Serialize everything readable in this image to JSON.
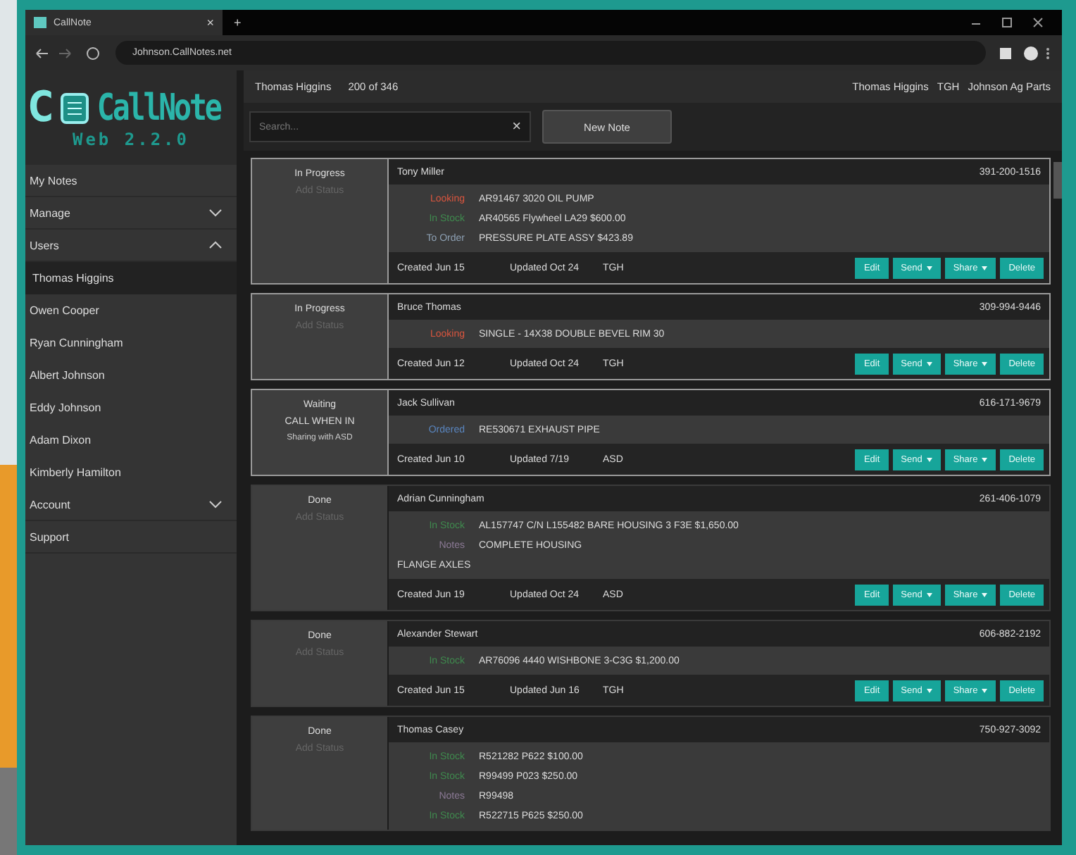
{
  "browser": {
    "tab_title": "CallNote",
    "tab_close": "×",
    "new_tab": "+",
    "url": "Johnson.CallNotes.net"
  },
  "logo": {
    "letter": "C",
    "name": "CallNote",
    "version": "Web 2.2.0"
  },
  "sidebar": {
    "items": [
      {
        "label": "My Notes",
        "kind": "link",
        "selected": false
      },
      {
        "label": "Manage",
        "kind": "group",
        "expanded": false
      },
      {
        "label": "Users",
        "kind": "group",
        "expanded": true
      },
      {
        "label": "Thomas Higgins",
        "kind": "user",
        "selected": true
      },
      {
        "label": "Owen Cooper",
        "kind": "user",
        "selected": false
      },
      {
        "label": "Ryan Cunningham",
        "kind": "user",
        "selected": false
      },
      {
        "label": "Albert Johnson",
        "kind": "user",
        "selected": false
      },
      {
        "label": "Eddy Johnson",
        "kind": "user",
        "selected": false
      },
      {
        "label": "Adam Dixon",
        "kind": "user",
        "selected": false
      },
      {
        "label": "Kimberly Hamilton",
        "kind": "user",
        "selected": false
      },
      {
        "label": "Account",
        "kind": "group",
        "expanded": false
      },
      {
        "label": "Support",
        "kind": "link",
        "selected": false
      }
    ]
  },
  "header": {
    "user": "Thomas Higgins",
    "count": "200 of 346",
    "account_user": "Thomas Higgins",
    "initials": "TGH",
    "company": "Johnson Ag Parts"
  },
  "search": {
    "placeholder": "Search...",
    "clear": "×"
  },
  "new_note": "New Note",
  "notes": [
    {
      "outlined": true,
      "status": "In Progress",
      "add_status": "Add Status",
      "name": "Tony Miller",
      "phone": "391-200-1516",
      "items": [
        {
          "tag": "Looking",
          "color": "#d9553e",
          "text": "AR91467 3020 OIL PUMP"
        },
        {
          "tag": "In Stock",
          "color": "#3f8a4e",
          "text": "AR40565 Flywheel LA29 $600.00"
        },
        {
          "tag": "To Order",
          "color": "#8da0b3",
          "text": "PRESSURE PLATE ASSY $423.89"
        }
      ],
      "created": "Created Jun 15",
      "updated": "Updated Oct 24",
      "by": "TGH",
      "buttons": [
        {
          "label": "Edit",
          "menu": false
        },
        {
          "label": "Send",
          "menu": true
        },
        {
          "label": "Share",
          "menu": true
        },
        {
          "label": "Delete",
          "menu": false
        }
      ]
    },
    {
      "outlined": true,
      "status": "In Progress",
      "add_status": "Add Status",
      "name": "Bruce Thomas",
      "phone": "309-994-9446",
      "items": [
        {
          "tag": "Looking",
          "color": "#d9553e",
          "text": "SINGLE - 14X38 DOUBLE BEVEL RIM 30"
        }
      ],
      "created": "Created Jun 12",
      "updated": "Updated Oct 24",
      "by": "TGH",
      "buttons": [
        {
          "label": "Edit",
          "menu": false
        },
        {
          "label": "Send",
          "menu": true
        },
        {
          "label": "Share",
          "menu": true
        },
        {
          "label": "Delete",
          "menu": false
        }
      ]
    },
    {
      "outlined": true,
      "status": "Waiting",
      "status_notes": [
        "CALL WHEN IN",
        "Sharing with ASD"
      ],
      "name": "Jack Sullivan",
      "phone": "616-171-9679",
      "items": [
        {
          "tag": "Ordered",
          "color": "#5a86c0",
          "text": "RE530671 EXHAUST PIPE"
        }
      ],
      "created": "Created Jun 10",
      "updated": "Updated 7/19",
      "by": "ASD",
      "buttons": [
        {
          "label": "Edit",
          "menu": false
        },
        {
          "label": "Send",
          "menu": true
        },
        {
          "label": "Share",
          "menu": true
        },
        {
          "label": "Delete",
          "menu": false
        }
      ]
    },
    {
      "outlined": false,
      "status": "Done",
      "add_status": "Add Status",
      "name": "Adrian Cunningham",
      "phone": "261-406-1079",
      "items": [
        {
          "tag": "In Stock",
          "color": "#3f8a4e",
          "text": "AL157747 C/N L155482 BARE HOUSING 3 F3E $1,650.00"
        },
        {
          "tag": "Notes",
          "color": "#8c7a96",
          "text": "COMPLETE HOUSING"
        },
        {
          "text": "FLANGE AXLES"
        }
      ],
      "created": "Created Jun 19",
      "updated": "Updated Oct 24",
      "by": "ASD",
      "buttons": [
        {
          "label": "Edit",
          "menu": false
        },
        {
          "label": "Send",
          "menu": true
        },
        {
          "label": "Share",
          "menu": true
        },
        {
          "label": "Delete",
          "menu": false
        }
      ]
    },
    {
      "outlined": false,
      "status": "Done",
      "add_status": "Add Status",
      "name": "Alexander Stewart",
      "phone": "606-882-2192",
      "items": [
        {
          "tag": "In Stock",
          "color": "#3f8a4e",
          "text": "AR76096 4440 WISHBONE 3-C3G $1,200.00"
        }
      ],
      "created": "Created Jun 15",
      "updated": "Updated Jun 16",
      "by": "TGH",
      "buttons": [
        {
          "label": "Edit",
          "menu": false
        },
        {
          "label": "Send",
          "menu": true
        },
        {
          "label": "Share",
          "menu": true
        },
        {
          "label": "Delete",
          "menu": false
        }
      ]
    },
    {
      "outlined": false,
      "status": "Done",
      "add_status": "Add Status",
      "name": "Thomas Casey",
      "phone": "750-927-3092",
      "items": [
        {
          "tag": "In Stock",
          "color": "#3f8a4e",
          "text": "R521282 P622 $100.00"
        },
        {
          "tag": "In Stock",
          "color": "#3f8a4e",
          "text": "R99499 P023 $250.00"
        },
        {
          "tag": "Notes",
          "color": "#8c7a96",
          "text": "R99498"
        },
        {
          "tag": "In Stock",
          "color": "#3f8a4e",
          "text": "R522715 P625 $250.00"
        }
      ]
    }
  ]
}
